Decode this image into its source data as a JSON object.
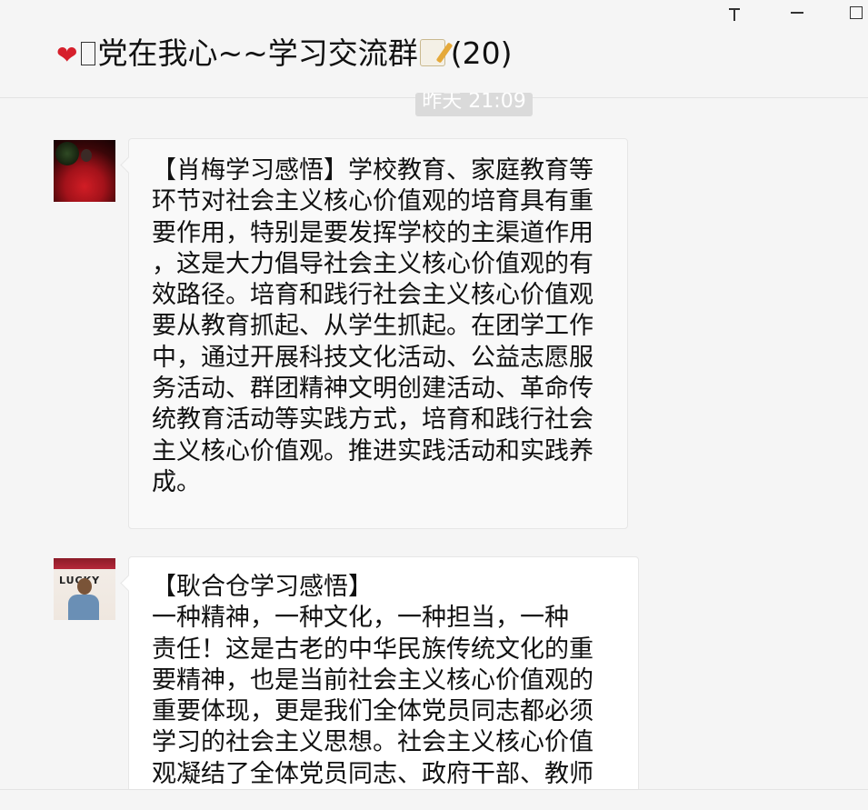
{
  "window": {
    "title": "党在我心~~学习交流群",
    "member_count": "(20)",
    "title_icons": [
      "heart-icon",
      "missing-glyph-box",
      "memo-icon"
    ]
  },
  "controls": {
    "pin": "pin-icon",
    "minimize": "minimize-icon",
    "maximize": "maximize-icon"
  },
  "timestamp": "昨天 21:09",
  "messages": [
    {
      "avatar": "avatar-red-dress",
      "text": "【肖梅学习感悟】学校教育、家庭教育等\n环节对社会主义核心价值观的培育具有重\n要作用，特别是要发挥学校的主渠道作用\n，这是大力倡导社会主义核心价值观的有\n效路径。培育和践行社会主义核心价值观\n要从教育抓起、从学生抓起。在团学工作\n中，通过开展科技文化活动、公益志愿服\n务活动、群团精神文明创建活动、革命传\n统教育活动等实践方式，培育和践行社会\n主义核心价值观。推进实践活动和实践养\n成。"
    },
    {
      "avatar": "avatar-man-phone",
      "avatar_sign_text": "LUCKY",
      "text": "【耿合仓学习感悟】\n  一种精神，一种文化，一种担当，一种\n责任！这是古老的中华民族传统文化的重\n要精神，也是当前社会主义核心价值观的\n重要体现，更是我们全体党员同志都必须\n学习的社会主义思想。社会主义核心价值\n观凝结了全体党员同志、政府干部、教师"
    }
  ],
  "colors": {
    "background": "#f5f5f5",
    "bubble": "#f9f9f9",
    "timestamp_bg": "#dadada",
    "heart": "#d6202c"
  }
}
